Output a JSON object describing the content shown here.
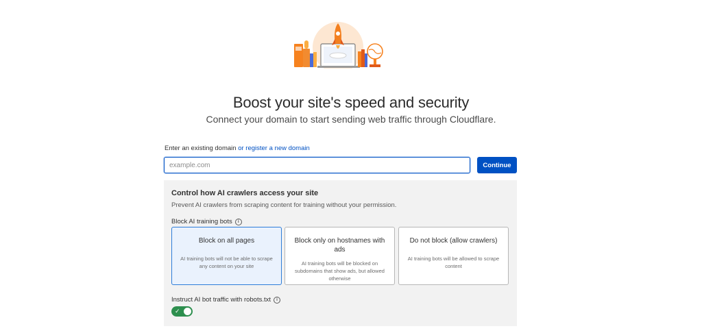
{
  "hero": {
    "illustration": "rocket-launch-illustration"
  },
  "header": {
    "title": "Boost your site's speed and security",
    "subtitle": "Connect your domain to start sending web traffic through Cloudflare."
  },
  "domain": {
    "label": "Enter an existing domain",
    "link": "or register a new domain",
    "placeholder": "example.com",
    "value": "",
    "continue_label": "Continue"
  },
  "ai_crawlers": {
    "title": "Control how AI crawlers access your site",
    "description": "Prevent AI crawlers from scraping content for training without your permission.",
    "block_label": "Block AI training bots",
    "info_icon": "info-icon",
    "selected_option": "Block on all pages",
    "options": [
      {
        "title": "Block on all pages",
        "description": "AI training bots will not be able to scrape any content on your site"
      },
      {
        "title": "Block only on hostnames with ads",
        "description": "AI training bots will be blocked on subdomains that show ads, but allowed otherwise"
      },
      {
        "title": "Do not block (allow crawlers)",
        "description": "AI training bots will be allowed to scrape content"
      }
    ],
    "robots_label": "Instruct AI bot traffic with robots.txt",
    "robots_enabled": true
  },
  "colors": {
    "accent": "#0051c3",
    "toggle_on": "#2d8f4e",
    "panel_bg": "#f2f2f2"
  }
}
